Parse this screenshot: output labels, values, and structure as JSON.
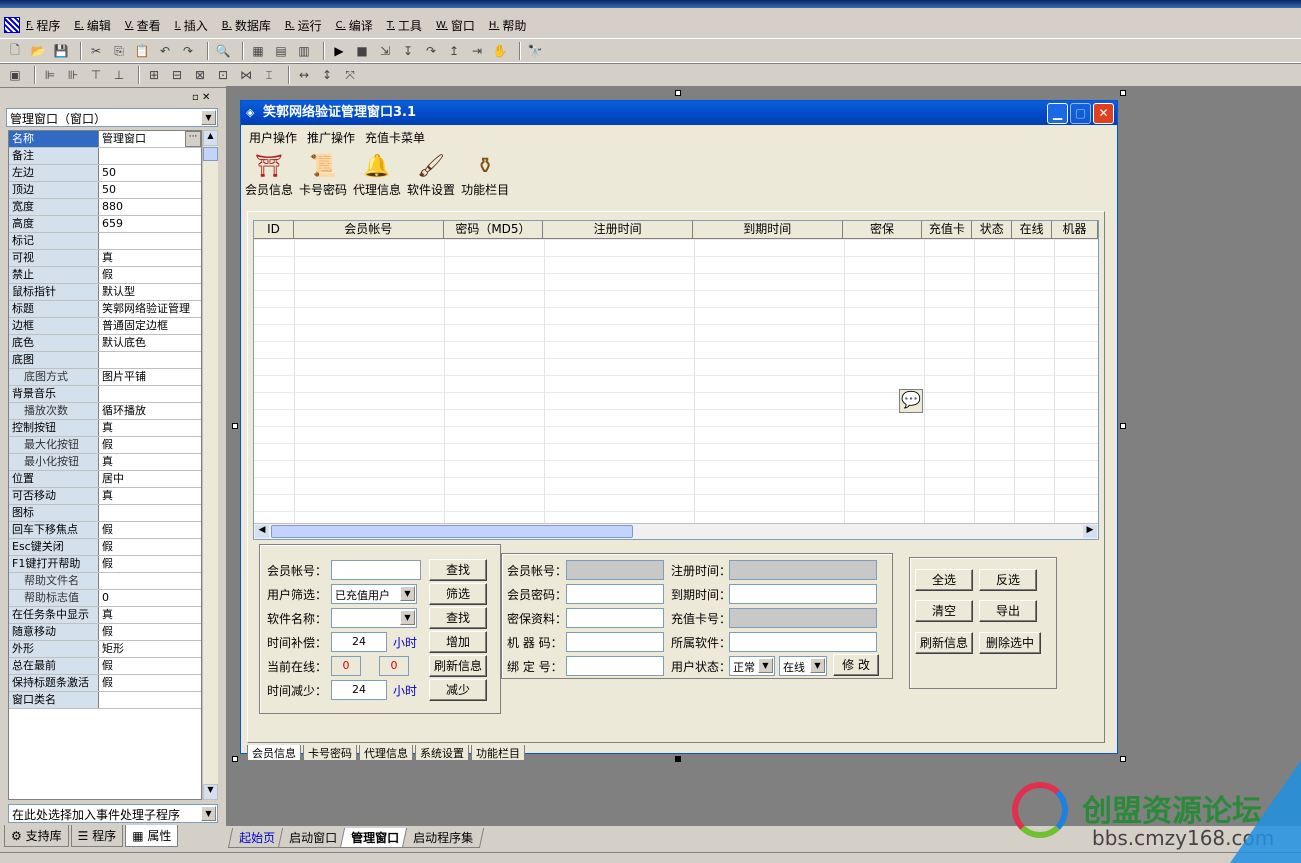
{
  "menubar": {
    "items": [
      {
        "key": "F.",
        "label": "程序"
      },
      {
        "key": "E.",
        "label": "编辑"
      },
      {
        "key": "V.",
        "label": "查看"
      },
      {
        "key": "I.",
        "label": "插入"
      },
      {
        "key": "B.",
        "label": "数据库"
      },
      {
        "key": "R.",
        "label": "运行"
      },
      {
        "key": "C.",
        "label": "编译"
      },
      {
        "key": "T.",
        "label": "工具"
      },
      {
        "key": "W.",
        "label": "窗口"
      },
      {
        "key": "H.",
        "label": "帮助"
      }
    ]
  },
  "props": {
    "selector": "管理窗口（窗口）",
    "event_selector": "在此处选择加入事件处理子程序",
    "rows": [
      {
        "name": "名称",
        "value": "管理窗口"
      },
      {
        "name": "备注",
        "value": ""
      },
      {
        "name": "左边",
        "value": "50"
      },
      {
        "name": "顶边",
        "value": "50"
      },
      {
        "name": "宽度",
        "value": "880"
      },
      {
        "name": "高度",
        "value": "659"
      },
      {
        "name": "标记",
        "value": ""
      },
      {
        "name": "可视",
        "value": "真"
      },
      {
        "name": "禁止",
        "value": "假"
      },
      {
        "name": "鼠标指针",
        "value": "默认型"
      },
      {
        "name": "标题",
        "value": "笑郭网络验证管理"
      },
      {
        "name": "边框",
        "value": "普通固定边框"
      },
      {
        "name": "底色",
        "value": "默认底色"
      },
      {
        "name": "底图",
        "value": ""
      },
      {
        "name": "底图方式",
        "value": "图片平铺"
      },
      {
        "name": "背景音乐",
        "value": ""
      },
      {
        "name": "播放次数",
        "value": "循环播放"
      },
      {
        "name": "控制按钮",
        "value": "真"
      },
      {
        "name": "最大化按钮",
        "value": "假"
      },
      {
        "name": "最小化按钮",
        "value": "真"
      },
      {
        "name": "位置",
        "value": "居中"
      },
      {
        "name": "可否移动",
        "value": "真"
      },
      {
        "name": "图标",
        "value": ""
      },
      {
        "name": "回车下移焦点",
        "value": "假"
      },
      {
        "name": "Esc键关闭",
        "value": "假"
      },
      {
        "name": "F1键打开帮助",
        "value": "假"
      },
      {
        "name": "帮助文件名",
        "value": ""
      },
      {
        "name": "帮助标志值",
        "value": "0"
      },
      {
        "name": "在任务条中显示",
        "value": "真"
      },
      {
        "name": "随意移动",
        "value": "假"
      },
      {
        "name": "外形",
        "value": "矩形"
      },
      {
        "name": "总在最前",
        "value": "假"
      },
      {
        "name": "保持标题条激活",
        "value": "假"
      },
      {
        "name": "窗口类名",
        "value": ""
      }
    ],
    "tabs": [
      "支持库",
      "程序",
      "属性"
    ]
  },
  "form": {
    "title": "笑郭网络验证管理窗口3.1",
    "menu": [
      "用户操作",
      "推广操作",
      "充值卡菜单"
    ],
    "icons": [
      {
        "label": "会员信息",
        "icon": "temple-icon"
      },
      {
        "label": "卡号密码",
        "icon": "scroll-icon"
      },
      {
        "label": "代理信息",
        "icon": "bell-icon"
      },
      {
        "label": "软件设置",
        "icon": "brush-icon"
      },
      {
        "label": "功能栏目",
        "icon": "cauldron-icon"
      }
    ],
    "grid_columns": [
      "ID",
      "会员帐号",
      "密码（MD5）",
      "注册时间",
      "到期时间",
      "密保",
      "充值卡",
      "状态",
      "在线",
      "机器"
    ],
    "left_panel": {
      "account_label": "会员帐号：",
      "filter_label": "用户筛选：",
      "filter_value": "已充值用户",
      "software_label": "软件名称：",
      "comp_label": "时间补偿：",
      "comp_value": "24",
      "unit": "小时",
      "online_label": "当前在线：",
      "online_a": "0",
      "online_b": "0",
      "reduce_label": "时间减少：",
      "reduce_value": "24",
      "btn_find": "查找",
      "btn_filter": "筛选",
      "btn_find2": "查找",
      "btn_add": "增加",
      "btn_refresh": "刷新信息",
      "btn_reduce": "减少"
    },
    "mid_panel": {
      "acct": "会员帐号：",
      "pwd": "会员密码：",
      "secret": "密保资料：",
      "machine": "机 器 码：",
      "bind": "绑 定 号：",
      "reg": "注册时间：",
      "expire": "到期时间：",
      "card": "充值卡号：",
      "soft": "所属软件：",
      "state": "用户状态：",
      "state_value": "正常",
      "online_value": "在线",
      "btn_modify": "修 改"
    },
    "right_panel": {
      "select_all": "全选",
      "invert": "反选",
      "clear": "清空",
      "export": "导出",
      "refresh": "刷新信息",
      "delete": "删除选中"
    },
    "bottom_tabs": [
      "会员信息",
      "卡号密码",
      "代理信息",
      "系统设置",
      "功能栏目"
    ]
  },
  "file_tabs": [
    "起始页",
    "启动窗口",
    "管理窗口",
    "启动程序集"
  ],
  "watermark": {
    "title": "创盟资源论坛",
    "url": "bbs.cmzy168.com"
  }
}
